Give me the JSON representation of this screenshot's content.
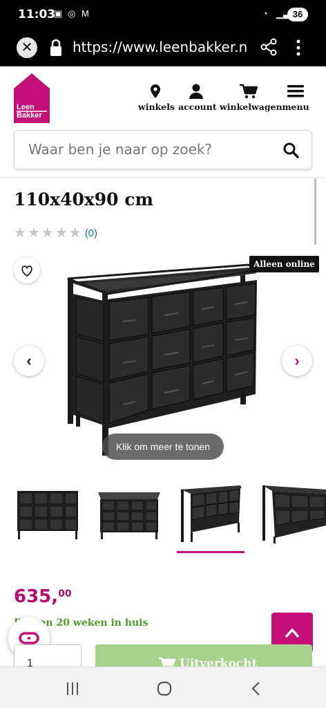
{
  "status_bar": {
    "time": "11:03",
    "battery": "36"
  },
  "browser": {
    "url": "https://www.leenbakker.nl/ka"
  },
  "brand": {
    "line1": "Leen",
    "line2": "Bakker",
    "color": "#c40f79"
  },
  "nav": [
    {
      "label": "winkels",
      "icon": "location-pin-icon"
    },
    {
      "label": "account",
      "icon": "user-icon"
    },
    {
      "label": "winkelwagen",
      "icon": "cart-icon"
    },
    {
      "label": "menu",
      "icon": "hamburger-icon"
    }
  ],
  "search": {
    "placeholder": "Waar ben je naar op zoek?"
  },
  "product": {
    "title": "110x40x90 cm",
    "rating_count": "(0)",
    "badge": "Alleen online",
    "tooltip": "Klik om meer te tonen",
    "price_int": "635,",
    "price_dec": "00",
    "delivery": "Binnen 20 weken in huis",
    "quantity": "1",
    "buy_label": "Uitverkocht"
  },
  "gallery": {
    "thumb_count": 4,
    "active_thumb": 3
  },
  "colors": {
    "accent": "#c40f79",
    "price": "#b50c6d",
    "delivery": "#4f9a2a",
    "disabled_button": "#a6d38b",
    "rating_link": "#1a6f93"
  }
}
